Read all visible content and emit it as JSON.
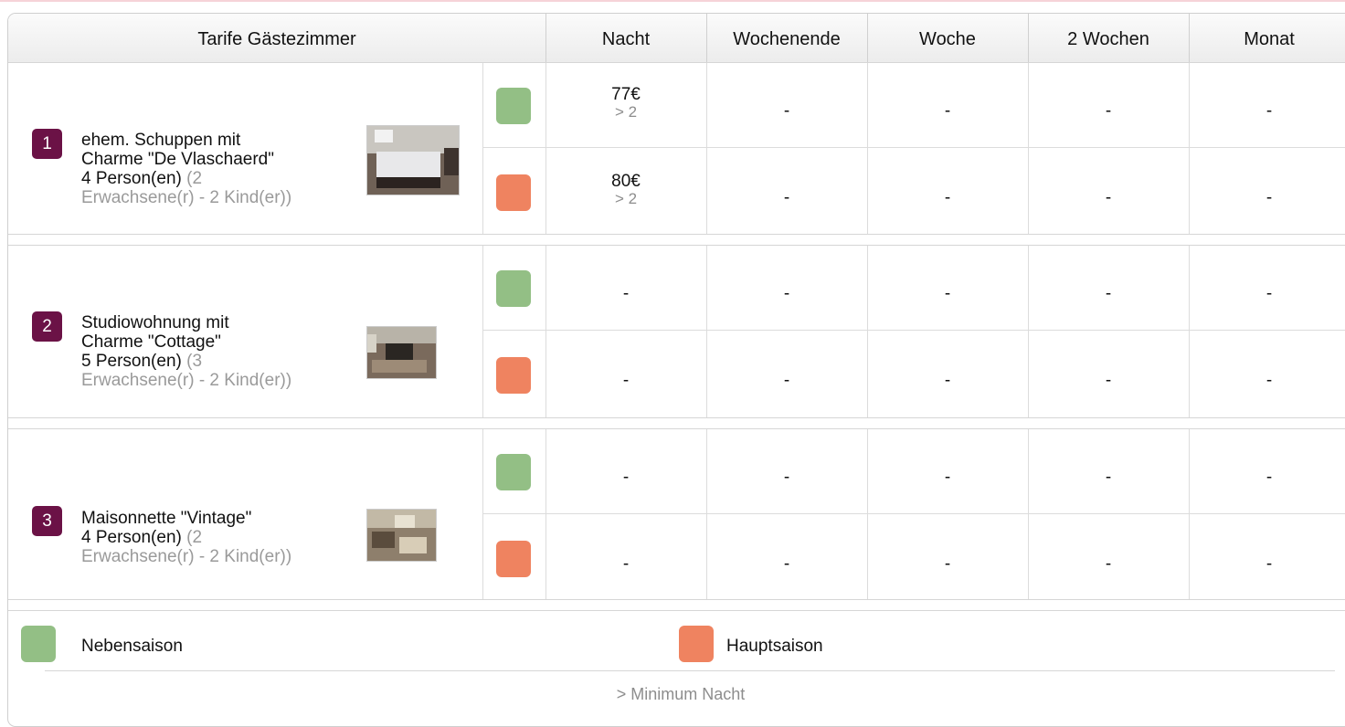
{
  "header": {
    "title": "Tarife Gästezimmer",
    "columns": [
      "Nacht",
      "Wochenende",
      "Woche",
      "2 Wochen",
      "Monat"
    ]
  },
  "rooms": [
    {
      "number": "1",
      "name_line1": "ehem. Schuppen mit",
      "name_line2": "Charme \"De Vlaschaerd\"",
      "persons": "4 Person(en)",
      "persons_detail_a": "(2",
      "persons_detail_b": "Erwachsene(r) - 2 Kind(er))",
      "low": {
        "nacht": "77€",
        "nacht_min": "> 2",
        "wochenende": "-",
        "woche": "-",
        "zwei_wochen": "-",
        "monat": "-"
      },
      "high": {
        "nacht": "80€",
        "nacht_min": "> 2",
        "wochenende": "-",
        "woche": "-",
        "zwei_wochen": "-",
        "monat": "-"
      }
    },
    {
      "number": "2",
      "name_line1": "Studiowohnung mit",
      "name_line2": "Charme \"Cottage\"",
      "persons": "5 Person(en)",
      "persons_detail_a": "(3",
      "persons_detail_b": "Erwachsene(r) - 2 Kind(er))",
      "low": {
        "nacht": "-",
        "wochenende": "-",
        "woche": "-",
        "zwei_wochen": "-",
        "monat": "-"
      },
      "high": {
        "nacht": "-",
        "wochenende": "-",
        "woche": "-",
        "zwei_wochen": "-",
        "monat": "-"
      }
    },
    {
      "number": "3",
      "name_line1": "Maisonnette \"Vintage\"",
      "persons": "4 Person(en)",
      "persons_detail_a": "(2",
      "persons_detail_b": "Erwachsene(r) - 2 Kind(er))",
      "low": {
        "nacht": "-",
        "wochenende": "-",
        "woche": "-",
        "zwei_wochen": "-",
        "monat": "-"
      },
      "high": {
        "nacht": "-",
        "wochenende": "-",
        "woche": "-",
        "zwei_wochen": "-",
        "monat": "-"
      }
    }
  ],
  "legend": {
    "low_label": "Nebensaison",
    "high_label": "Hauptsaison",
    "footnote": "> Minimum Nacht"
  },
  "colors": {
    "low_season": "#93bf85",
    "high_season": "#ef8360",
    "badge": "#6b1246"
  }
}
